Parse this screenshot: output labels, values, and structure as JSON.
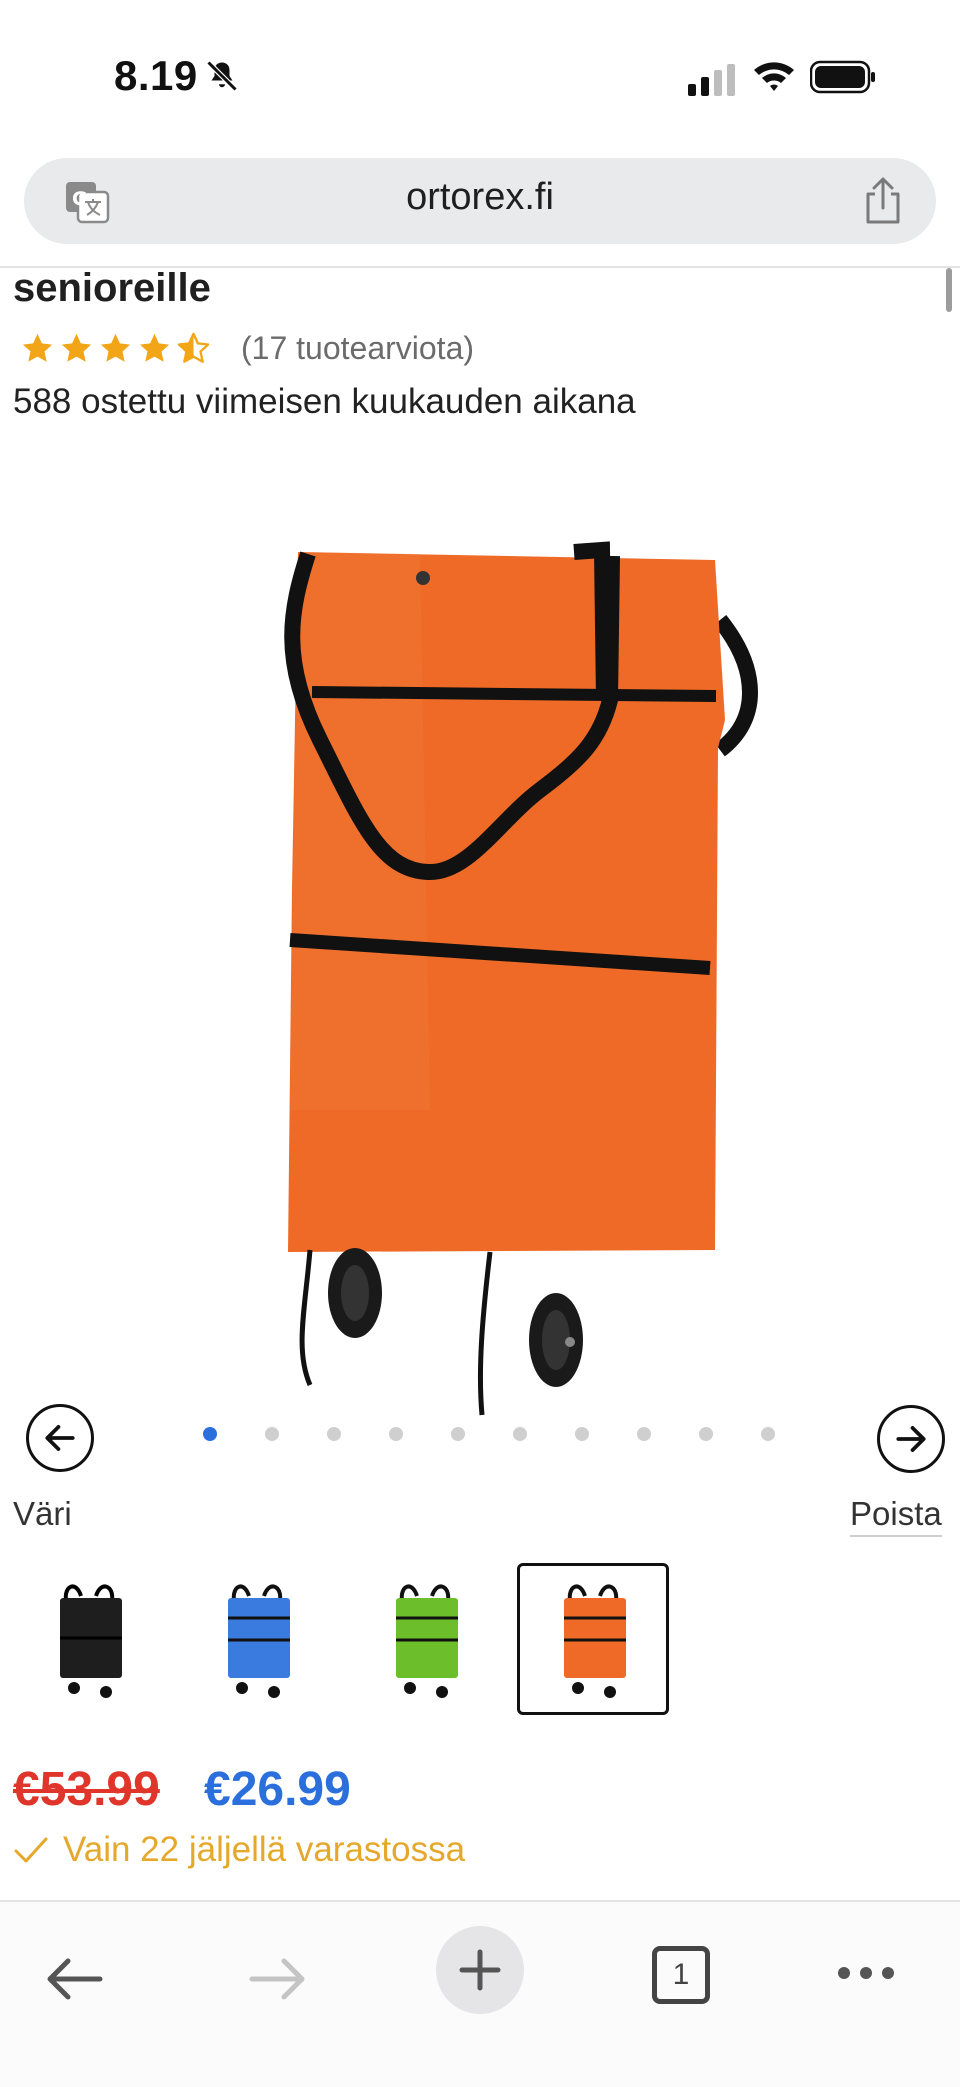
{
  "status_bar": {
    "time": "8.19"
  },
  "browser": {
    "url": "ortorex.fi"
  },
  "product": {
    "title_partial": "senioreille",
    "rating": 4.5,
    "review_count_text": "(17 tuotearviota)",
    "purchased_text": "588 ostettu viimeisen kuukauden aikana"
  },
  "carousel": {
    "image_count": 10,
    "active_index": 0
  },
  "variant": {
    "label": "Väri",
    "remove_label": "Poista",
    "swatches": [
      {
        "name": "black",
        "color": "#1e1e1e",
        "selected": false
      },
      {
        "name": "blue",
        "color": "#3a7be0",
        "selected": false
      },
      {
        "name": "green",
        "color": "#6cbf2a",
        "selected": false
      },
      {
        "name": "orange",
        "color": "#ee6a26",
        "selected": true
      }
    ]
  },
  "price": {
    "old": "€53.99",
    "new": "€26.99"
  },
  "stock": {
    "text": "Vain 22 jäljellä varastossa"
  },
  "toolbar": {
    "tab_count": "1"
  },
  "colors": {
    "accent_blue": "#2a6fdb",
    "sale_red": "#e0352b",
    "stock_yellow": "#e5a82a",
    "product_orange": "#ee6a26",
    "star_gold": "#f2a516"
  }
}
